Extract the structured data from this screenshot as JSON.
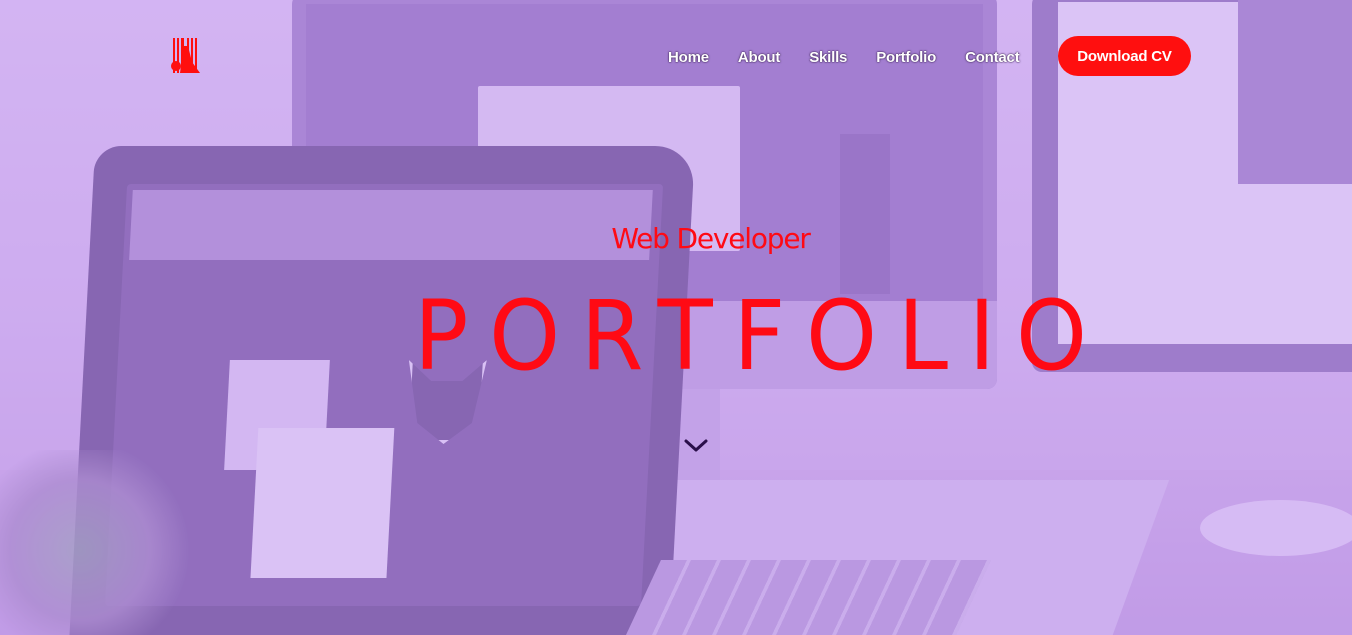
{
  "header": {
    "logo_alt": "logo",
    "nav": [
      {
        "label": "Home"
      },
      {
        "label": "About"
      },
      {
        "label": "Skills"
      },
      {
        "label": "Portfolio"
      },
      {
        "label": "Contact"
      }
    ],
    "cta_label": "Download CV"
  },
  "hero": {
    "subtitle": "Web Developer",
    "title": "PORTFOLIO",
    "scroll_icon": "chevron-down-icon"
  },
  "colors": {
    "accent": "#ff0f0f",
    "title": "#ff0a14",
    "overlay": "#be96f0",
    "nav_text": "#ffffff",
    "chevron": "#2a0f4a"
  }
}
